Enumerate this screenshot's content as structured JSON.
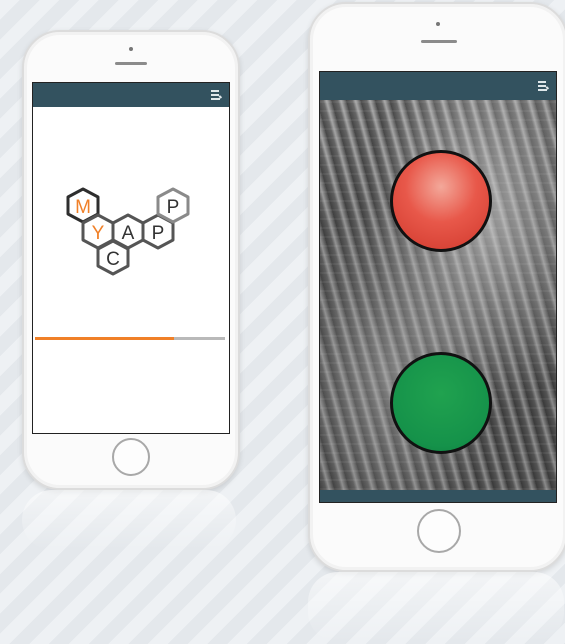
{
  "brand": {
    "logo_letters": [
      "M",
      "Y",
      "C",
      "A",
      "P",
      "P"
    ],
    "accent_color": "#f08028",
    "bar_color": "#33525f"
  },
  "splash": {
    "progress": 0.73
  },
  "signal": {
    "lights": [
      {
        "state": "stop",
        "color": "#e8584a"
      },
      {
        "state": "go",
        "color": "#15924a"
      }
    ]
  },
  "icons": {
    "menu": "menu-icon"
  }
}
